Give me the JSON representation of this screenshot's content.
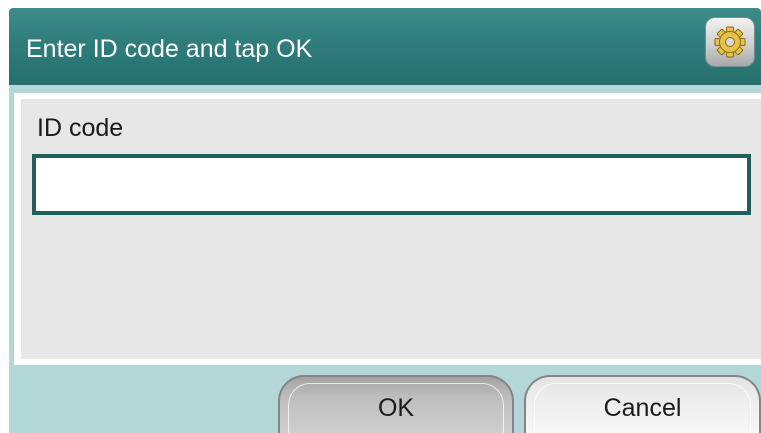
{
  "dialog": {
    "title": "Enter ID code and tap OK",
    "settings_icon": "gear-icon"
  },
  "form": {
    "field_label": "ID code",
    "field_value": "",
    "field_placeholder": ""
  },
  "buttons": {
    "ok_label": "OK",
    "cancel_label": "Cancel"
  },
  "colors": {
    "title_bar": "#2f7d7b",
    "lower_band": "#b3d6d6",
    "panel": "#e7e7e7",
    "input_border": "#1f5f5c"
  }
}
